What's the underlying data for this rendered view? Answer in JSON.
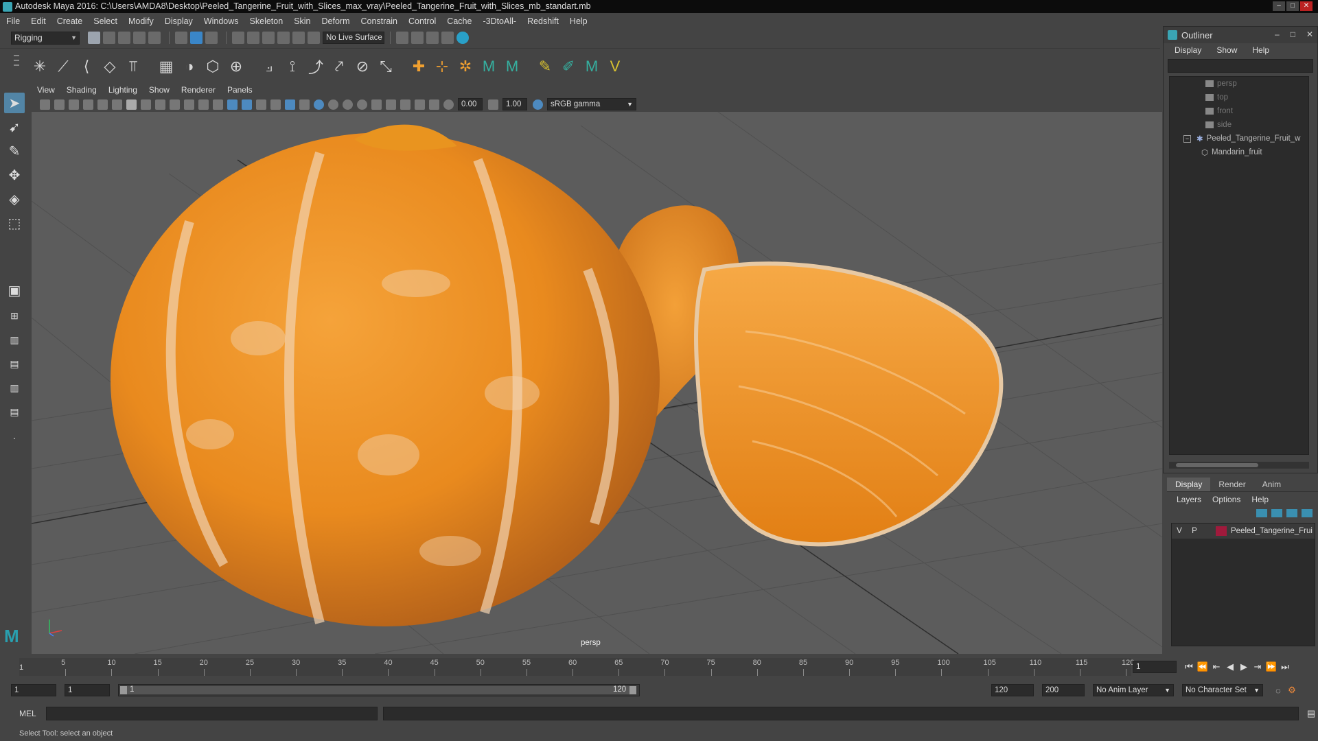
{
  "window": {
    "title": "Autodesk Maya 2016: C:\\Users\\AMDA8\\Desktop\\Peeled_Tangerine_Fruit_with_Slices_max_vray\\Peeled_Tangerine_Fruit_with_Slices_mb_standart.mb"
  },
  "menubar": [
    "File",
    "Edit",
    "Create",
    "Select",
    "Modify",
    "Display",
    "Windows",
    "Skeleton",
    "Skin",
    "Deform",
    "Constrain",
    "Control",
    "Cache",
    "-3DtoAll-",
    "Redshift",
    "Help"
  ],
  "statusline": {
    "mode": "Rigging",
    "live_surface": "No Live Surface"
  },
  "viewport": {
    "menu": [
      "View",
      "Shading",
      "Lighting",
      "Show",
      "Renderer",
      "Panels"
    ],
    "exposure": "0.00",
    "gamma": "1.00",
    "color_space": "sRGB gamma",
    "camera_label": "persp"
  },
  "outliner": {
    "title": "Outliner",
    "menu": [
      "Display",
      "Show",
      "Help"
    ],
    "cameras": [
      "persp",
      "top",
      "front",
      "side"
    ],
    "group": "Peeled_Tangerine_Fruit_w",
    "child": "Mandarin_fruit"
  },
  "layers": {
    "tabs": [
      "Display",
      "Render",
      "Anim"
    ],
    "menu": [
      "Layers",
      "Options",
      "Help"
    ],
    "row": {
      "v": "V",
      "p": "P",
      "name": "Peeled_Tangerine_Frui"
    }
  },
  "timeslider": {
    "ticks": [
      "5",
      "10",
      "15",
      "20",
      "25",
      "30",
      "35",
      "40",
      "45",
      "50",
      "55",
      "60",
      "65",
      "70",
      "75",
      "80",
      "85",
      "90",
      "95",
      "100",
      "105",
      "110",
      "115",
      "120"
    ],
    "current": "1",
    "current_frame_field": "1"
  },
  "range": {
    "start": "1",
    "playback_start": "1",
    "slider_start": "1",
    "slider_end": "120",
    "playback_end": "120",
    "end": "200",
    "anim_layer": "No Anim Layer",
    "character_set": "No Character Set"
  },
  "cmdline": {
    "label": "MEL"
  },
  "help_line": "Select Tool: select an object",
  "colors": {
    "accent": "#5285a6",
    "maya_teal": "#29a0b0",
    "layer_swatch": "#a01a3c",
    "tangerine": "#f08a1c"
  }
}
